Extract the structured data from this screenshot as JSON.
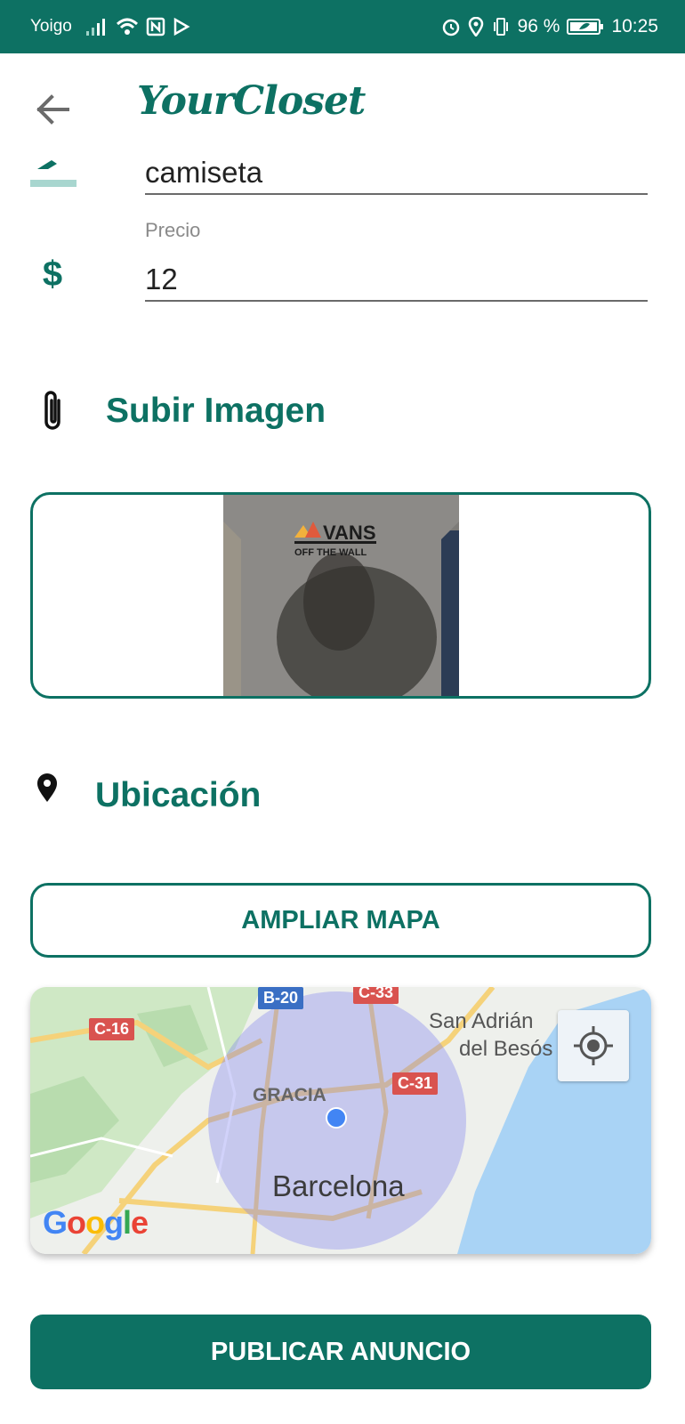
{
  "status_bar": {
    "carrier": "Yoigo",
    "battery": "96 %",
    "time": "10:25"
  },
  "app": {
    "title": "YourCloset"
  },
  "form": {
    "name_value": "camiseta",
    "price_label": "Precio",
    "price_value": "12"
  },
  "image_section": {
    "title": "Subir Imagen",
    "shirt_brand": "VANS",
    "shirt_tagline": "OFF THE WALL"
  },
  "location_section": {
    "title": "Ubicación",
    "expand_button": "AMPLIAR MAPA"
  },
  "map": {
    "city": "Barcelona",
    "district": "GRACIA",
    "nearby_town_line1": "San Adrián",
    "nearby_town_line2": "del Besós",
    "roads": [
      "C-16",
      "B-20",
      "C-33",
      "C-31"
    ],
    "provider": "Google"
  },
  "actions": {
    "publish_button": "PUBLICAR ANUNCIO"
  },
  "colors": {
    "primary": "#0d7163",
    "location_dot": "#4285f4"
  }
}
